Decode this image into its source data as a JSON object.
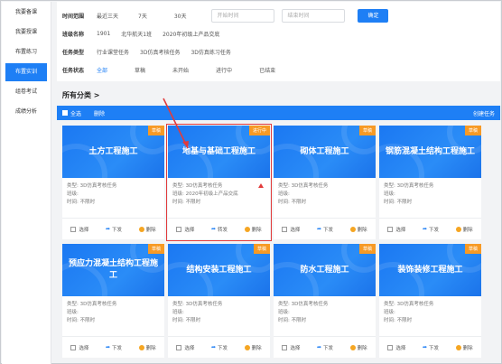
{
  "sidebar": {
    "items": [
      {
        "label": "我要备课",
        "active": false
      },
      {
        "label": "我要授课",
        "active": false
      },
      {
        "label": "布置练习",
        "active": false
      },
      {
        "label": "布置实训",
        "active": true
      },
      {
        "label": "组卷考试",
        "active": false
      },
      {
        "label": "成绩分析",
        "active": false
      }
    ]
  },
  "filters": {
    "time": {
      "label": "时间范围",
      "options": [
        "最近三天",
        "7天",
        "30天"
      ],
      "start_placeholder": "开始时间",
      "end_placeholder": "结束时间",
      "confirm": "确定"
    },
    "grade": {
      "label": "班级名称",
      "options": [
        "1901",
        "北华航天1班",
        "2020年初级上产品交底"
      ]
    },
    "type": {
      "label": "任务类型",
      "options": [
        "行业课堂任务",
        "3D仿真考核任务",
        "3D仿真练习任务"
      ]
    },
    "status": {
      "label": "任务状态",
      "options": [
        "全部",
        "草稿",
        "未开始",
        "进行中",
        "已结束"
      ],
      "selected": 0
    }
  },
  "section_title": "所有分类 >",
  "toolbar": {
    "select_all": "全选",
    "delete": "删除",
    "create": "创建任务"
  },
  "colors": {
    "accent": "#1e7ff5",
    "badge": "#f79a25",
    "highlight": "#e23b3b"
  },
  "card_labels": {
    "type": "类型:",
    "grade": "班级:",
    "time": "时间:",
    "select": "选择",
    "publish": "下发",
    "forward": "转发",
    "delete": "删除"
  },
  "cards": [
    {
      "title": "土方工程施工",
      "badge": "草稿",
      "type": "3D仿真考核任务",
      "grade": "",
      "time": "不限时",
      "action": "下发"
    },
    {
      "title": "地基与基础工程施工",
      "badge": "进行中",
      "type": "3D仿真考核任务",
      "grade": "2020年初级上产品交底",
      "time": "不限时",
      "action": "转发",
      "highlighted": true
    },
    {
      "title": "砌体工程施工",
      "badge": "草稿",
      "type": "3D仿真考核任务",
      "grade": "",
      "time": "不限时",
      "action": "下发"
    },
    {
      "title": "钢筋混凝土结构工程施工",
      "badge": "草稿",
      "type": "3D仿真考核任务",
      "grade": "",
      "time": "不限时",
      "action": "下发"
    },
    {
      "title": "预应力混凝土结构工程施工",
      "badge": "草稿",
      "type": "3D仿真考核任务",
      "grade": "",
      "time": "不限时",
      "action": "下发"
    },
    {
      "title": "结构安装工程施工",
      "badge": "草稿",
      "type": "3D仿真考核任务",
      "grade": "",
      "time": "不限时",
      "action": "下发"
    },
    {
      "title": "防水工程施工",
      "badge": "草稿",
      "type": "3D仿真考核任务",
      "grade": "",
      "time": "不限时",
      "action": "下发"
    },
    {
      "title": "装饰装修工程施工",
      "badge": "草稿",
      "type": "3D仿真考核任务",
      "grade": "",
      "time": "不限时",
      "action": "下发"
    }
  ]
}
